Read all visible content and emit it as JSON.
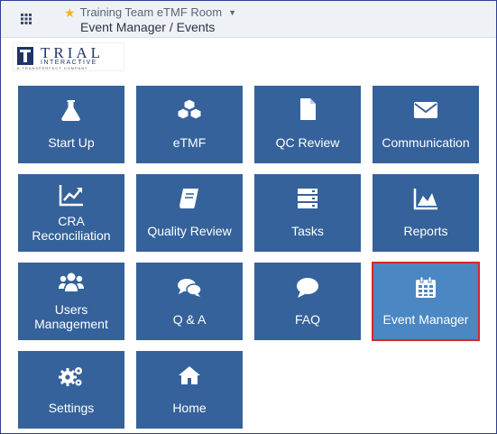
{
  "header": {
    "room_label": "Training Team eTMF Room",
    "breadcrumb": "Event Manager / Events"
  },
  "logo": {
    "main": "TRIAL",
    "sub": "INTERACTIVE",
    "tagline": "A TRANSPERFECT COMPANY"
  },
  "tiles": {
    "start_up": "Start Up",
    "etmf": "eTMF",
    "qc_review": "QC Review",
    "communication": "Communication",
    "cra_reconciliation": "CRA Reconciliation",
    "quality_review": "Quality Review",
    "tasks": "Tasks",
    "reports": "Reports",
    "users_management": "Users Management",
    "qa": "Q & A",
    "faq": "FAQ",
    "event_manager": "Event Manager",
    "settings": "Settings",
    "home": "Home"
  },
  "colors": {
    "tile": "#35629a",
    "tile_active": "#4b87c2",
    "highlight_border": "#d8262c",
    "star": "#f3b41c"
  },
  "icons": [
    "grid-icon",
    "star-icon",
    "caret-down-icon",
    "flask-icon",
    "cubes-icon",
    "file-icon",
    "envelope-icon",
    "line-chart-icon",
    "book-icon",
    "server-icon",
    "area-chart-icon",
    "users-icon",
    "comments-icon",
    "comment-icon",
    "calendar-icon",
    "cogs-icon",
    "home-icon"
  ]
}
